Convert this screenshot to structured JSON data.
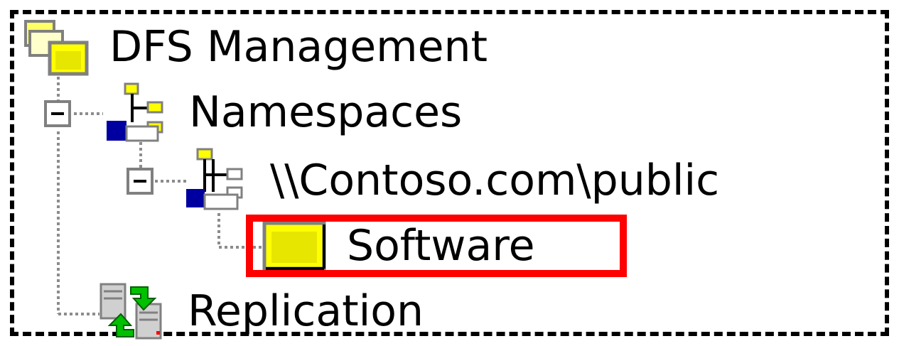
{
  "tree": {
    "root": {
      "label": "DFS Management",
      "icon": "dfs-management-icon"
    },
    "namespaces": {
      "label": "Namespaces",
      "icon": "namespaces-icon",
      "expanded": true
    },
    "namespace_path": {
      "label": "\\\\Contoso.com\\public",
      "icon": "namespace-root-icon",
      "expanded": true
    },
    "folder": {
      "label": "Software",
      "icon": "folder-icon",
      "selected": true
    },
    "replication": {
      "label": "Replication",
      "icon": "replication-icon"
    }
  },
  "colors": {
    "selection_outline": "#ff0000",
    "folder_yellow": "#ffff00",
    "connector_gray": "#808080",
    "server_blue": "#0000a0",
    "replication_green": "#00c000"
  }
}
